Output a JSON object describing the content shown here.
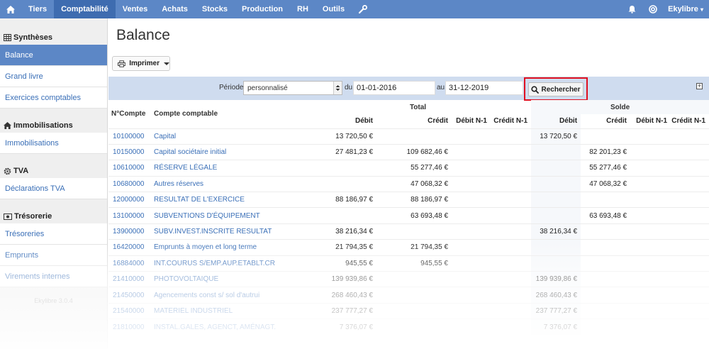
{
  "topnav": {
    "tabs": [
      "Tiers",
      "Comptabilité",
      "Ventes",
      "Achats",
      "Stocks",
      "Production",
      "RH",
      "Outils"
    ],
    "user": "Ekylibre"
  },
  "sidebar": {
    "sections": [
      {
        "title": "Synthèses",
        "items": [
          "Balance",
          "Grand livre",
          "Exercices comptables"
        ]
      },
      {
        "title": "Immobilisations",
        "items": [
          "Immobilisations"
        ]
      },
      {
        "title": "TVA",
        "items": [
          "Déclarations TVA"
        ]
      },
      {
        "title": "Trésorerie",
        "items": [
          "Trésoreries",
          "Emprunts",
          "Virements internes"
        ]
      }
    ],
    "version": "Ekylibre 3.0.4"
  },
  "page": {
    "title": "Balance",
    "print_label": "Imprimer"
  },
  "filter": {
    "period_label": "Période",
    "period_value": "personnalisé",
    "from_label": "du",
    "from_value": "01-01-2016",
    "to_label": "au",
    "to_value": "31-12-2019",
    "search_label": "Rechercher"
  },
  "table": {
    "headers": {
      "account": "N°Compte",
      "label": "Compte comptable",
      "total": "Total",
      "solde": "Solde",
      "debit": "Débit",
      "credit": "Crédit",
      "debit_n1": "Débit N-1",
      "credit_n1": "Crédit N-1"
    },
    "rows": [
      [
        "10100000",
        "Capital",
        "13 720,50 €",
        "",
        "13 720,50 €",
        ""
      ],
      [
        "10150000",
        "Capital sociétaire initial",
        "27 481,23 €",
        "109 682,46 €",
        "",
        "82 201,23 €"
      ],
      [
        "10610000",
        "RÉSERVE LÉGALE",
        "",
        "55 277,46 €",
        "",
        "55 277,46 €"
      ],
      [
        "10680000",
        "Autres réserves",
        "",
        "47 068,32 €",
        "",
        "47 068,32 €"
      ],
      [
        "12000000",
        "RESULTAT DE L'EXERCICE",
        "88 186,97 €",
        "88 186,97 €",
        "",
        ""
      ],
      [
        "13100000",
        "SUBVENTIONS D'ÉQUIPEMENT",
        "",
        "63 693,48 €",
        "",
        "63 693,48 €"
      ],
      [
        "13900000",
        "SUBV.INVEST.INSCRITE RESULTAT",
        "38 216,34 €",
        "",
        "38 216,34 €",
        ""
      ],
      [
        "16420000",
        "Emprunts à moyen et long terme",
        "21 794,35 €",
        "21 794,35 €",
        "",
        ""
      ],
      [
        "16884000",
        "INT.COURUS S/EMP.AUP.ETABLT.CR",
        "945,55 €",
        "945,55 €",
        "",
        ""
      ],
      [
        "21410000",
        "PHOTOVOLTAIQUE",
        "139 939,86 €",
        "",
        "139 939,86 €",
        ""
      ],
      [
        "21450000",
        "Agencements const s/ sol d'autrui",
        "268 460,43 €",
        "",
        "268 460,43 €",
        ""
      ],
      [
        "21540000",
        "MATERIEL INDUSTRIEL",
        "237 777,27 €",
        "",
        "237 777,27 €",
        ""
      ],
      [
        "21810000",
        "INSTAL.GALES, AGENCT, AMÉNAGT.",
        "7 376,07 €",
        "",
        "7 376,07 €",
        ""
      ]
    ]
  }
}
